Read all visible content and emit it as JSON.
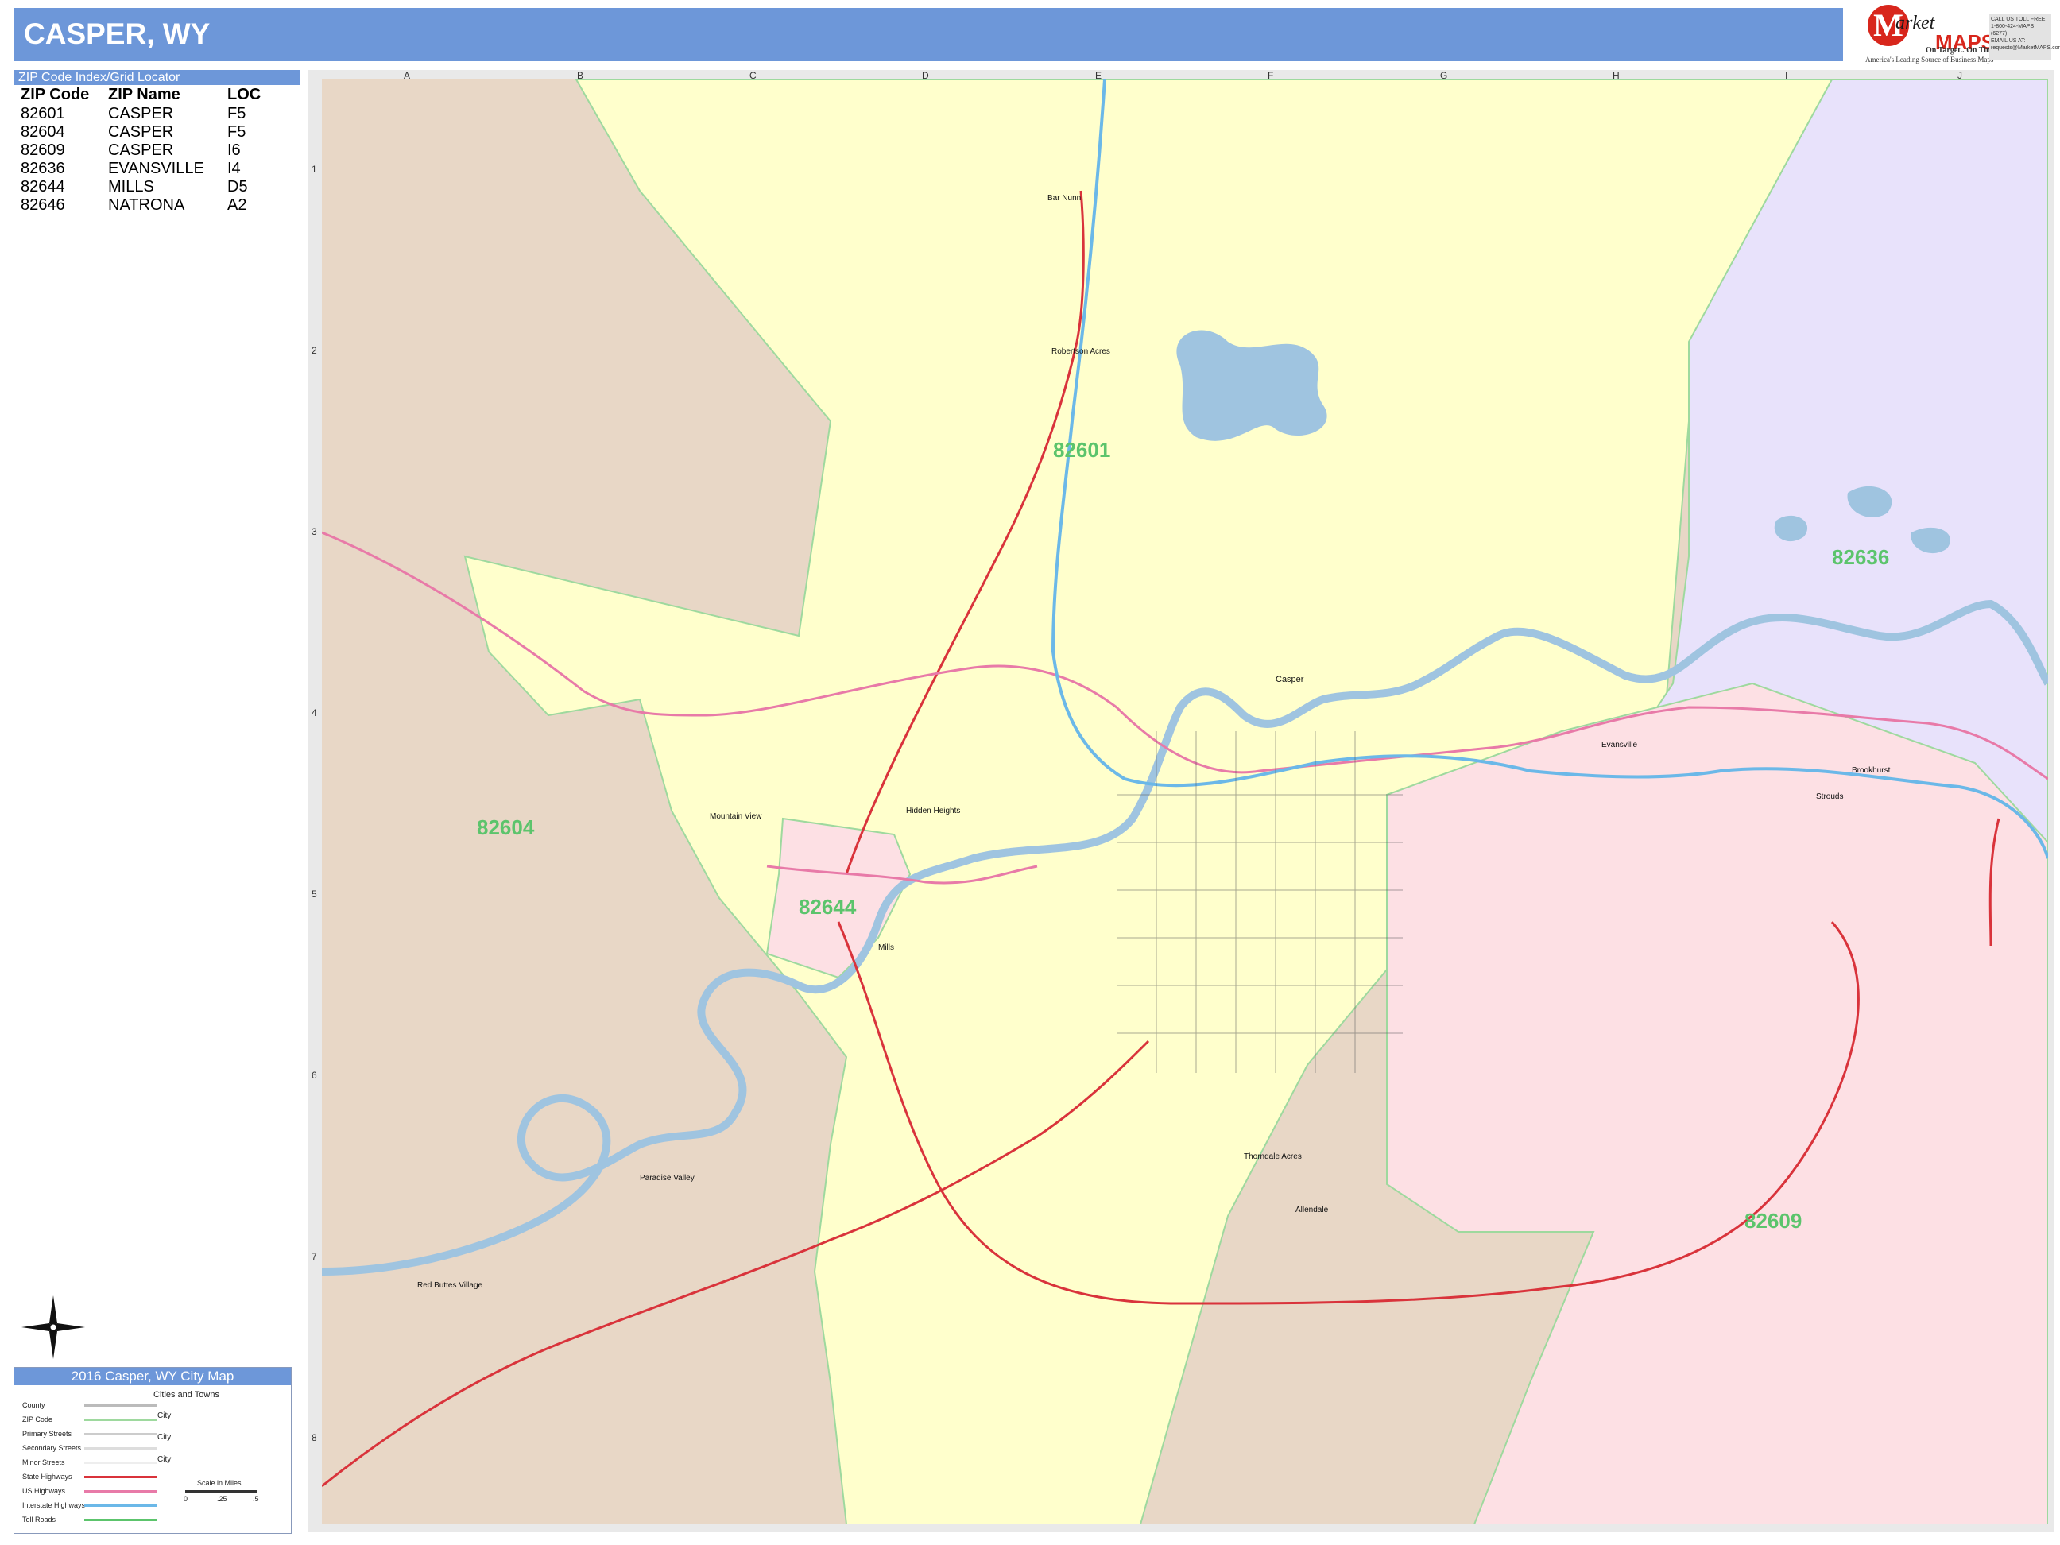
{
  "header": {
    "title": "CASPER, WY"
  },
  "logo": {
    "letter": "M",
    "word": "arket",
    "maps": "MAPS",
    "tagline": "On Target.. On Time.",
    "tagline2": "America's Leading Source of Business Maps",
    "contact": [
      "CALL US TOLL FREE:",
      "1-800-424-MAPS (6277)",
      "EMAIL US AT:",
      "requests@MarketMAPS.com"
    ]
  },
  "zip_index": {
    "heading": "ZIP Code Index/Grid Locator",
    "columns": [
      "ZIP Code",
      "ZIP Name",
      "LOC"
    ],
    "rows": [
      [
        "82601",
        "CASPER",
        "F5"
      ],
      [
        "82604",
        "CASPER",
        "F5"
      ],
      [
        "82609",
        "CASPER",
        "I6"
      ],
      [
        "82636",
        "EVANSVILLE",
        "I4"
      ],
      [
        "82644",
        "MILLS",
        "D5"
      ],
      [
        "82646",
        "NATRONA",
        "A2"
      ]
    ]
  },
  "grid": {
    "columns": [
      "A",
      "B",
      "C",
      "D",
      "E",
      "F",
      "G",
      "H",
      "I",
      "J"
    ],
    "rows": [
      "1",
      "2",
      "3",
      "4",
      "5",
      "6",
      "7",
      "8"
    ]
  },
  "zip_labels": [
    {
      "zip": "82601",
      "area_color": "#ffffcc"
    },
    {
      "zip": "82604",
      "area_color": "#e8d7c6"
    },
    {
      "zip": "82636",
      "area_color": "#e8e2fb"
    },
    {
      "zip": "82609",
      "area_color": "#fde0e4"
    },
    {
      "zip": "82644",
      "area_color": "#fde0e4"
    }
  ],
  "place_labels": [
    "Casper",
    "Evansville",
    "Mills",
    "Bar Nunn",
    "Mountain View",
    "Red Buttes Village",
    "Paradise Valley",
    "Allendale",
    "Thorndale Acres",
    "Brookhurst",
    "Strouds",
    "Hidden Heights",
    "Robertson Acres"
  ],
  "legend": {
    "title": "2016 Casper, WY City Map",
    "items": [
      "County",
      "ZIP Code",
      "Primary Streets",
      "Secondary Streets",
      "Minor Streets",
      "State Highways",
      "US Highways",
      "Interstate Highways",
      "Toll Roads"
    ],
    "cities_heading": "Cities and Towns",
    "city_label": "City",
    "scale_label": "Scale in Miles",
    "scale_ticks": [
      "0",
      ".25",
      ".5"
    ]
  },
  "colors": {
    "header": "#6d97d9",
    "water": "#9fc4e0",
    "interstate": "#6bb8e8",
    "us_highway": "#e87aa8",
    "state_highway": "#d9333b",
    "zip_label": "#5cc46c"
  }
}
